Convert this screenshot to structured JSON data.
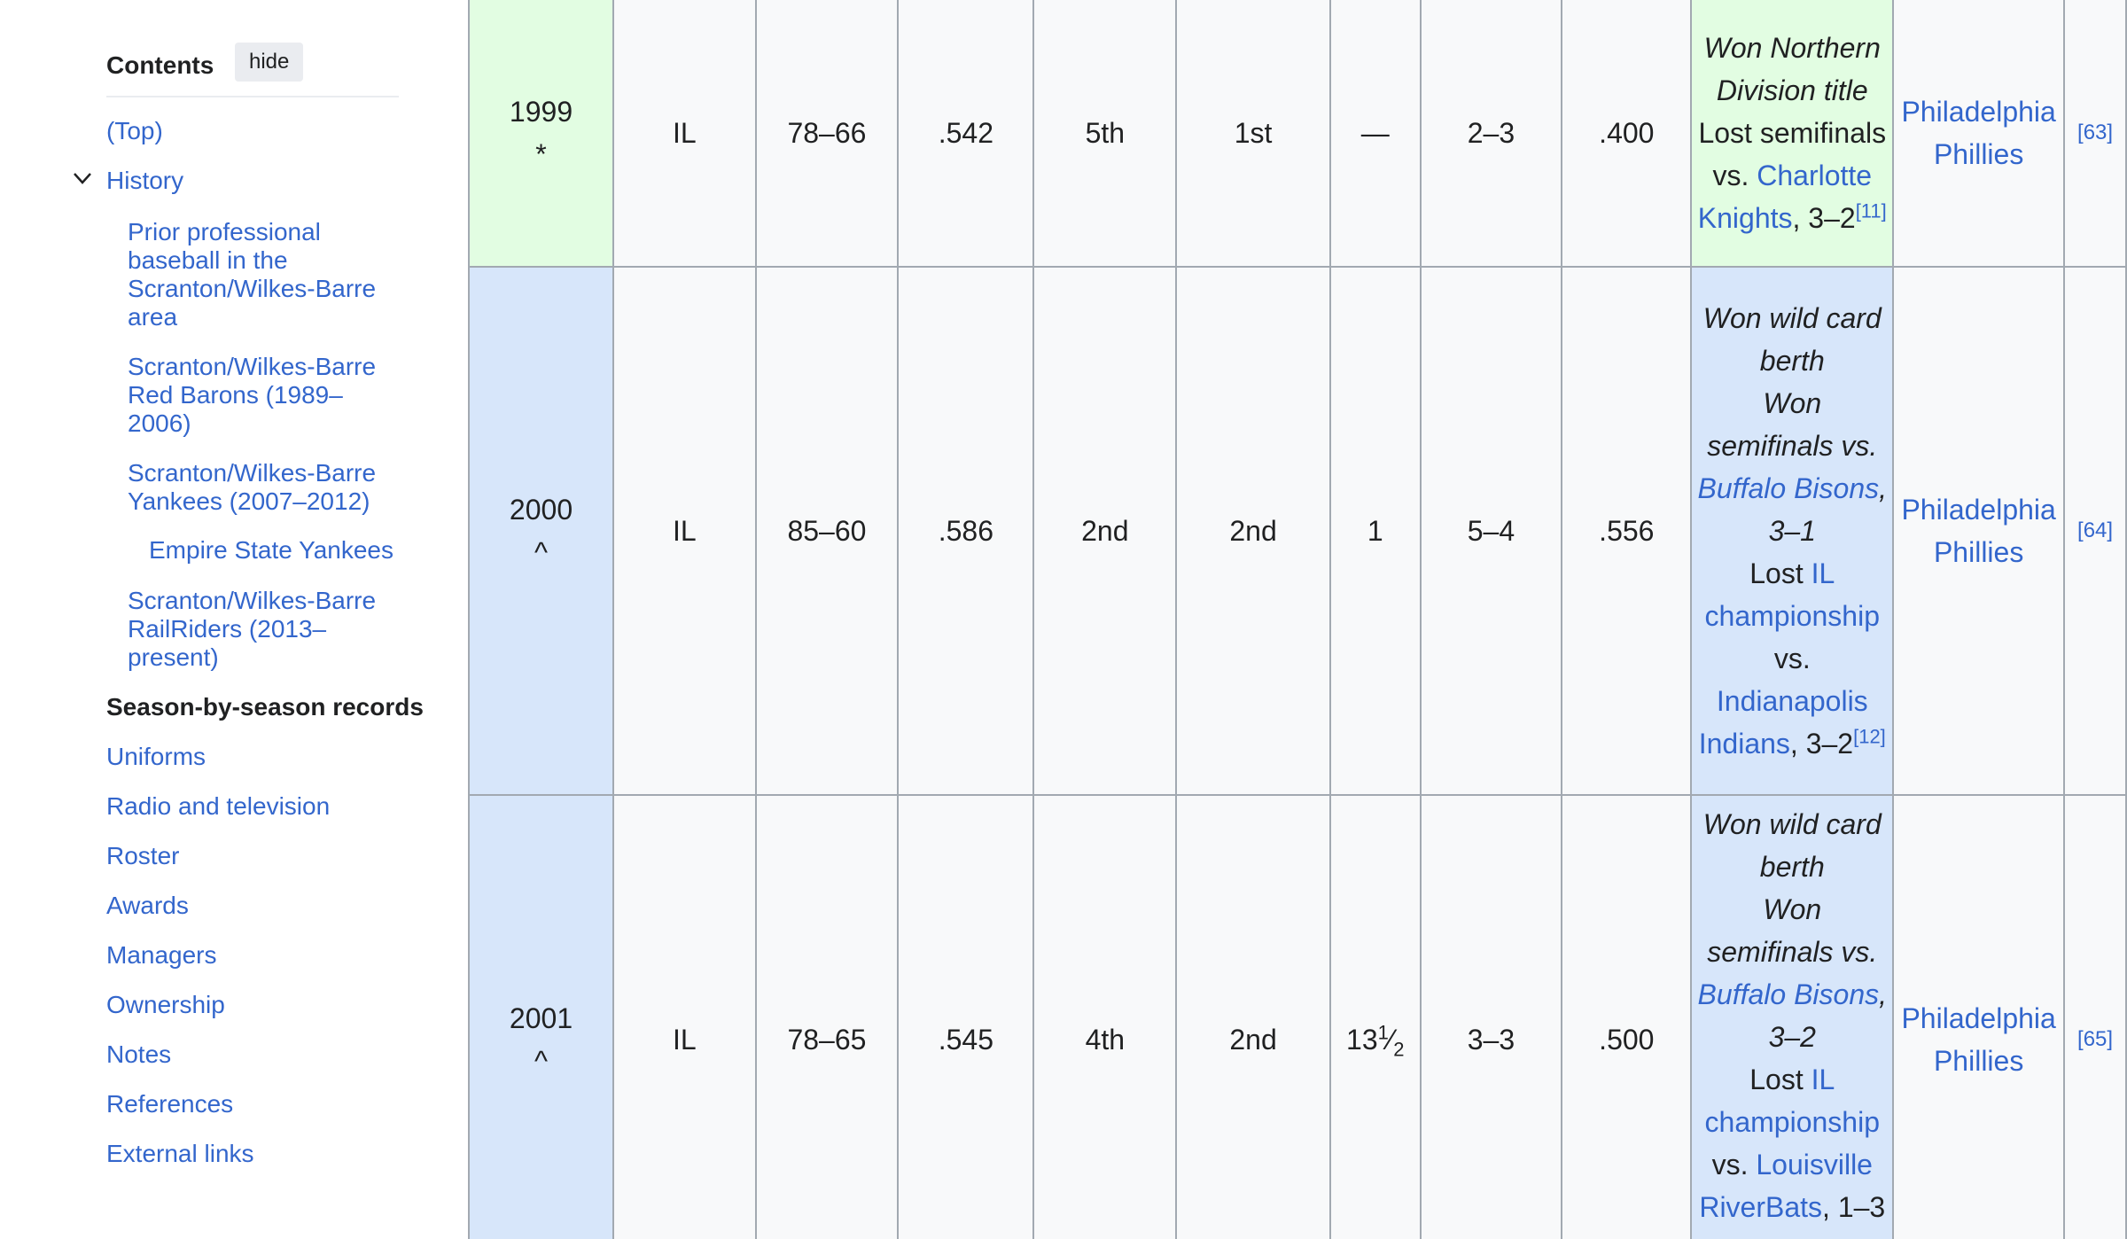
{
  "toc": {
    "title": "Contents",
    "hide_label": "hide",
    "items": {
      "top": "(Top)",
      "history": "History",
      "history_sub1": "Prior professional baseball in the Scranton/Wilkes-Barre area",
      "history_sub2": "Scranton/Wilkes-Barre Red Barons (1989–2006)",
      "history_sub3": "Scranton/Wilkes-Barre Yankees (2007–2012)",
      "history_sub3_sub": "Empire State Yankees",
      "history_sub4": "Scranton/Wilkes-Barre RailRiders (2013–present)",
      "season": "Season-by-season records",
      "uniforms": "Uniforms",
      "radio": "Radio and television",
      "roster": "Roster",
      "awards": "Awards",
      "managers": "Managers",
      "ownership": "Ownership",
      "notes": "Notes",
      "references": "References",
      "external": "External links"
    }
  },
  "rows": [
    {
      "year": "1999",
      "mark": "*",
      "league": "IL",
      "record": "78–66",
      "pct": ".542",
      "league_finish": "5th",
      "div_finish": "1st",
      "gb": "—",
      "po_record": "2–3",
      "po_pct": ".400",
      "p1": "Won Northern Division title",
      "p2": "Lost semifinals vs.",
      "p2_link": "Charlotte Knights",
      "p2_end": ", 3–2",
      "p2_ref": "[11]",
      "affiliate": "Philadelphia Phillies",
      "ref": "[63]"
    },
    {
      "year": "2000",
      "mark": "^",
      "league": "IL",
      "record": "85–60",
      "pct": ".586",
      "league_finish": "2nd",
      "div_finish": "2nd",
      "gb": "1",
      "po_record": "5–4",
      "po_pct": ".556",
      "p1": "Won wild card berth",
      "p2": "Won semifinals vs.",
      "p2_link": "Buffalo Bisons",
      "p2_end": ", 3–1",
      "p3": "Lost",
      "p3_link": "IL championship",
      "p3_mid": "vs.",
      "p3_link2": "Indianapolis Indians",
      "p3_end": ", 3–2",
      "p3_ref": "[12]",
      "affiliate": "Philadelphia Phillies",
      "ref": "[64]"
    },
    {
      "year": "2001",
      "mark": "^",
      "league": "IL",
      "record": "78–65",
      "pct": ".545",
      "league_finish": "4th",
      "div_finish": "2nd",
      "gb_whole": "13",
      "gb_num": "1",
      "gb_den": "2",
      "po_record": "3–3",
      "po_pct": ".500",
      "p1": "Won wild card berth",
      "p2": "Won semifinals vs.",
      "p2_link": "Buffalo Bisons",
      "p2_end": ", 3–2",
      "p3": "Lost",
      "p3_link": "IL championship",
      "p3_mid": "vs.",
      "p3_link2": "Louisville RiverBats",
      "p3_end": ", 1–3",
      "affiliate": "Philadelphia Phillies",
      "ref": "[65]"
    }
  ]
}
